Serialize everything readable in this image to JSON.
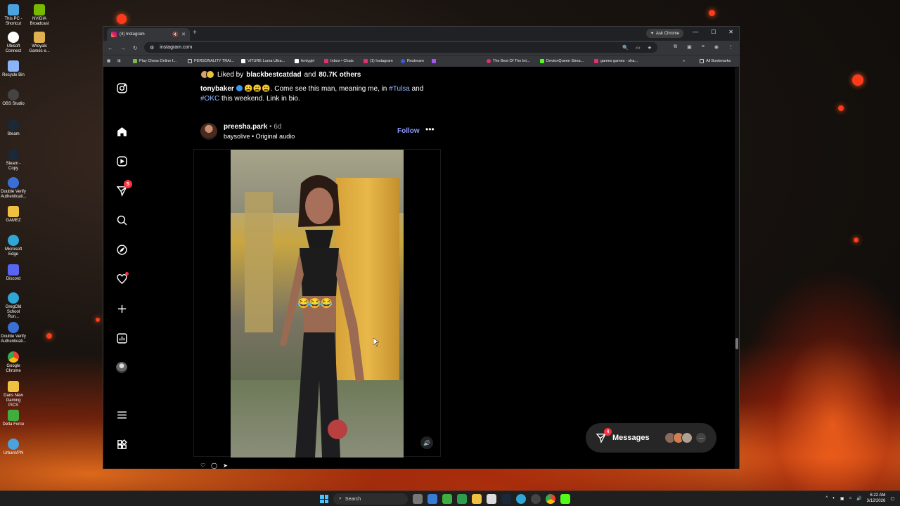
{
  "desktop": {
    "icons": [
      {
        "label": "This PC - Shortcut",
        "color": "#4aa3df"
      },
      {
        "label": "NVIDIA Broadcast",
        "color": "#76b900"
      },
      {
        "label": "Ubisoft Connect",
        "color": "#ffffff"
      },
      {
        "label": "Wroyals Games e...",
        "color": "#e0b050"
      },
      {
        "label": "Recycle Bin",
        "color": "#8ab4f8"
      },
      {
        "label": "OBS Studio",
        "color": "#333333"
      },
      {
        "label": "Steam",
        "color": "#1b2838"
      },
      {
        "label": "Steam - Copy",
        "color": "#1b2838"
      },
      {
        "label": "Double Verify Authenticati...",
        "color": "#3a6fd8"
      },
      {
        "label": "GAMEZ",
        "color": "#f0c040"
      },
      {
        "label": "Microsoft Edge",
        "color": "#2fa7d6"
      },
      {
        "label": "Discord",
        "color": "#5865f2"
      },
      {
        "label": "GregOld School Run...",
        "color": "#2fa7d6"
      },
      {
        "label": "Double Verify Authenticati...",
        "color": "#3a6fd8"
      },
      {
        "label": "Google Chrome",
        "color": "#ea4335"
      },
      {
        "label": "Dans New Gaming PICS",
        "color": "#f0c040"
      },
      {
        "label": "Delta Force",
        "color": "#3fae3f"
      },
      {
        "label": "UrbanVPN",
        "color": "#4aa3df"
      }
    ]
  },
  "browser": {
    "tab_title": "(4) Instagram",
    "new_tab": "+",
    "ask_chrome": "Ask Chrome",
    "url": "instagram.com",
    "bookmarks": [
      {
        "label": "Play Chess Online f...",
        "color": "#81b64c"
      },
      {
        "label": "PERSONALITY TRAI...",
        "color": "#cccccc"
      },
      {
        "label": "VITURE Luma Ultra...",
        "color": "#ffffff"
      },
      {
        "label": "fentygirl",
        "color": "#ffffff"
      },
      {
        "label": "Inbox • Chats",
        "color": "#e1306c"
      },
      {
        "label": "(1) Instagram",
        "color": "#e1306c"
      },
      {
        "label": "Restream",
        "color": "#3b5bdb"
      },
      {
        "label": "The Best Of The Int...",
        "color": "#e1306c"
      },
      {
        "label": "DevtenQueen Strea...",
        "color": "#53fc18"
      },
      {
        "label": "games games - sha...",
        "color": "#e1306c"
      }
    ],
    "all_bookmarks": "All Bookmarks"
  },
  "instagram": {
    "sidebar": {
      "notifications_count": "5"
    },
    "prev_post": {
      "liked_by_prefix": "Liked by",
      "liked_by_user": "blackbestcatdad",
      "liked_by_and": "and",
      "liked_by_count": "80.7K others",
      "caption_user": "tonybaker",
      "caption_emojis": "😩😩😩",
      "caption_text_1": ". Come see this man, meaning me, in",
      "caption_tag_1": "#Tulsa",
      "caption_and": "and",
      "caption_tag_2": "#OKC",
      "caption_text_2": "this weekend. Link in bio."
    },
    "post": {
      "username": "preesha.park",
      "time": "• 6d",
      "audio": "baysolive • Original audio",
      "follow": "Follow",
      "more": "•••",
      "video_emojis": "😂😂😂"
    },
    "messages": {
      "label": "Messages",
      "badge": "4",
      "more": "···"
    }
  },
  "taskbar": {
    "search_placeholder": "Search",
    "time": "6:22 AM",
    "date": "3/12/2026"
  }
}
